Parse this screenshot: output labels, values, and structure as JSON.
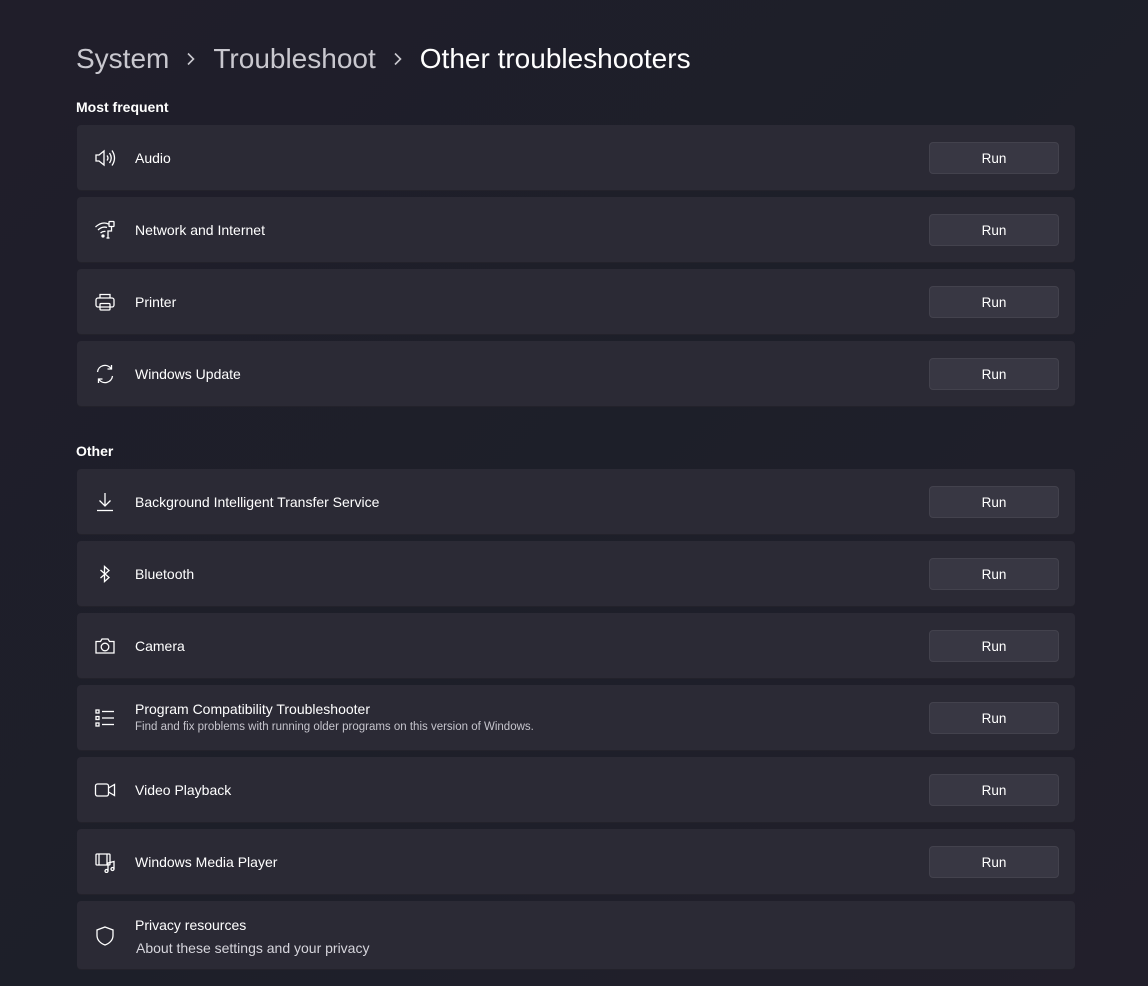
{
  "breadcrumb": {
    "items": [
      "System",
      "Troubleshoot",
      "Other troubleshooters"
    ]
  },
  "sections": {
    "most_frequent": {
      "title": "Most frequent",
      "items": [
        {
          "label": "Audio",
          "icon": "speaker-icon",
          "button": "Run"
        },
        {
          "label": "Network and Internet",
          "icon": "network-wifi-icon",
          "button": "Run"
        },
        {
          "label": "Printer",
          "icon": "printer-icon",
          "button": "Run"
        },
        {
          "label": "Windows Update",
          "icon": "sync-icon",
          "button": "Run"
        }
      ]
    },
    "other": {
      "title": "Other",
      "items": [
        {
          "label": "Background Intelligent Transfer Service",
          "icon": "download-icon",
          "button": "Run"
        },
        {
          "label": "Bluetooth",
          "icon": "bluetooth-icon",
          "button": "Run"
        },
        {
          "label": "Camera",
          "icon": "camera-icon",
          "button": "Run"
        },
        {
          "label": "Program Compatibility Troubleshooter",
          "description": "Find and fix problems with running older programs on this version of Windows.",
          "icon": "list-icon",
          "button": "Run"
        },
        {
          "label": "Video Playback",
          "icon": "video-camera-icon",
          "button": "Run"
        },
        {
          "label": "Windows Media Player",
          "icon": "media-player-icon",
          "button": "Run"
        }
      ]
    }
  },
  "privacy": {
    "title": "Privacy resources",
    "link": "About these settings and your privacy",
    "icon": "shield-icon"
  },
  "colors": {
    "background": "#201e2a",
    "card": "#2b2a35",
    "button": "#383743",
    "text": "#ffffff",
    "muted_text": "#c9c8cf"
  }
}
